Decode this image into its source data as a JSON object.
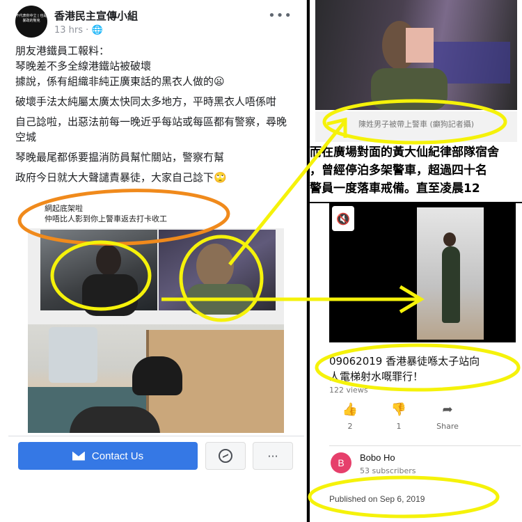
{
  "post": {
    "avatar_text": "不代表你中立 | 也是暴政的幫兇",
    "page_name": "香港民主宣傳小組",
    "time": "13 hrs · ",
    "globe_icon": "globe-icon",
    "paragraphs": [
      "朋友港鐵員工報料：",
      "琴晚差不多全線港鐵站被破壞",
      "據說，係有組織非純正廣東話的黑衣人做的",
      "破壞手法太純屬太廣太快同太多地方，平時黑衣人唔係咁",
      "自己諗啦，出惡法前每一晚近乎每站或每區都有警察，尋晚空城",
      "琴晚最尾都係要揾消防員幫忙關站，警察冇幫",
      "政府今日就大大聲譴責暴徒，大家自己諗下"
    ],
    "emoji_1": "😦",
    "emoji_2": "🙄",
    "image_caption_line1": "網起底架啦",
    "image_caption_line2": "仲唔比人影到你上警車返去打卡收工",
    "contact_label": "Contact Us",
    "more_label": "···"
  },
  "news": {
    "photo_caption": "陳姓男子被帶上警車 (癲狗記者攝)",
    "text_lines": [
      "而在廣場對面的黃大仙紀律部隊宿舍",
      "，曾經停泊多架警車，超過四十名",
      "警員一度落車戒備。直至凌晨12"
    ]
  },
  "video": {
    "title_line1": "09062019 香港暴徒喺太子站向",
    "title_line2": "人電梯射水嘅罪行！",
    "views": "122 views",
    "likes": "2",
    "dislikes": "1",
    "share_label": "Share",
    "channel_initial": "B",
    "channel_name": "Bobo Ho",
    "subscribers": "53 subscribers",
    "published": "Published on Sep 6, 2019"
  },
  "colors": {
    "fb_blue": "#3578e5",
    "annotation_yellow": "#f5f20a",
    "annotation_orange": "#f08a1c"
  }
}
